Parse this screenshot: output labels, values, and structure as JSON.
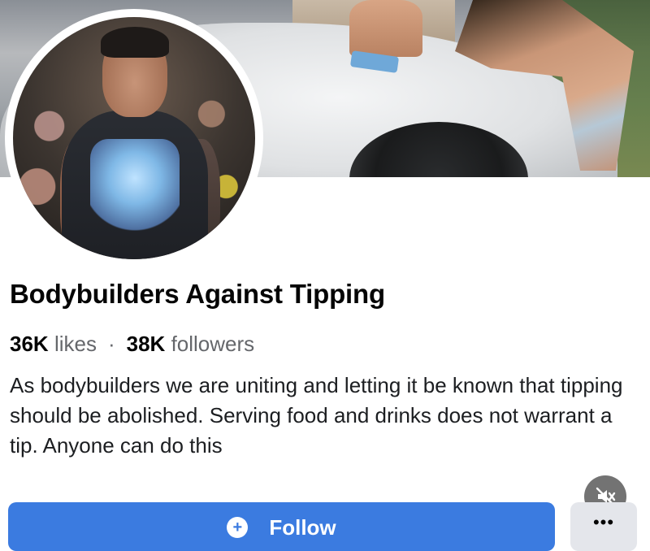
{
  "page": {
    "name": "Bodybuilders Against Tipping",
    "likes_count": "36K",
    "likes_label": "likes",
    "separator": "·",
    "followers_count": "38K",
    "followers_label": "followers",
    "bio": "As bodybuilders we are uniting and letting it be known that tipping should be abolished. Serving food and drinks does not warrant a tip. Anyone can do this"
  },
  "actions": {
    "follow_label": "Follow",
    "follow_icon": "follow-plus-icon",
    "more_icon": "more-options-icon",
    "more_symbol": "•••"
  },
  "overlay": {
    "mute_icon": "muted-speaker-icon"
  },
  "colors": {
    "follow_button": "#3b7be0",
    "more_button": "#e4e6eb",
    "title_text": "#050505",
    "secondary_text": "#65676b"
  }
}
